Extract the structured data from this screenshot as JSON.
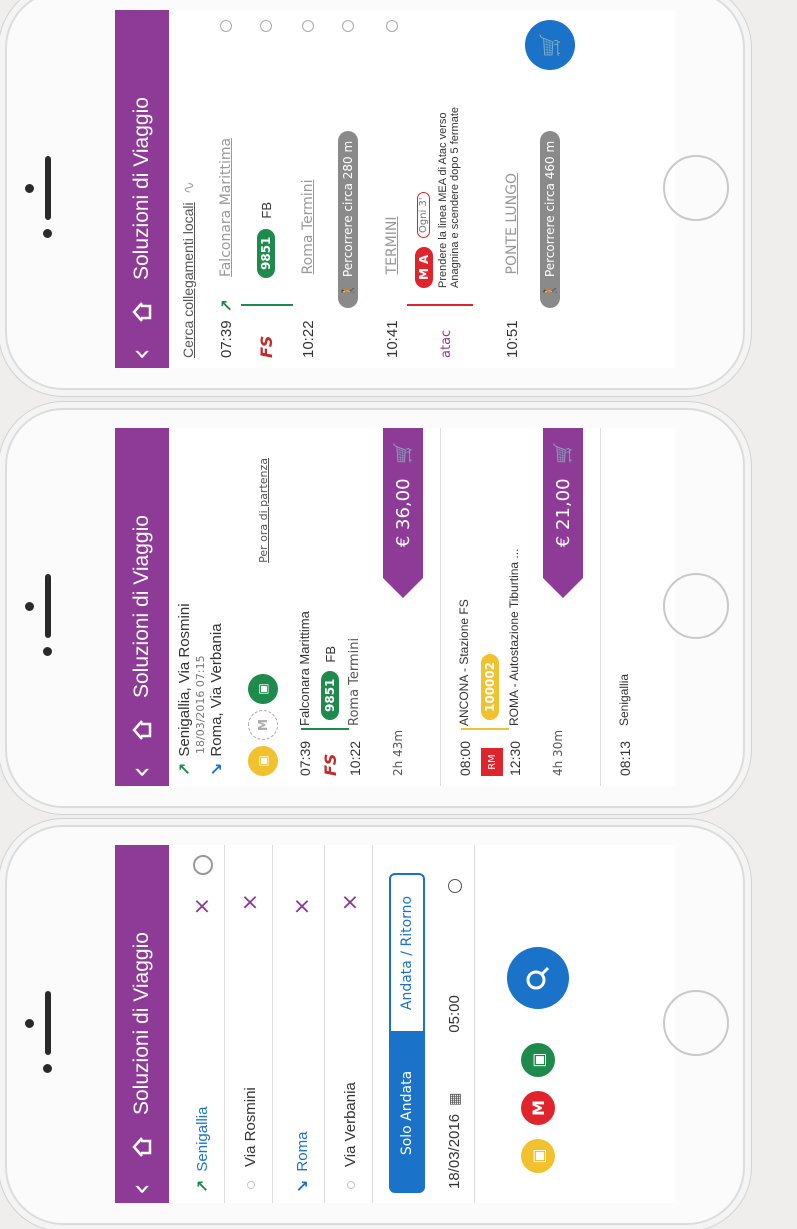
{
  "header": {
    "title": "Soluzioni di Viaggio",
    "back": "‹"
  },
  "search": {
    "from_city": "Senigallia",
    "from_street": "Via Rosmini",
    "to_city": "Roma",
    "to_street": "Via Verbania",
    "tab_oneway": "Solo Andata",
    "tab_return": "Andata / Ritorno",
    "date": "18/03/2016",
    "time": "05:00"
  },
  "results": {
    "from": "Senigallia, Via Rosmini",
    "datetime": "18/03/2016 07:15",
    "to": "Roma, Via Verbania",
    "sort_label": "Per ora di partenza",
    "sol1": {
      "dep_time": "07:39",
      "arr_time": "10:22",
      "dep_station": "Falconara Marittima",
      "arr_station": "Roma Termini",
      "train": "9851",
      "train_type": "FB",
      "duration": "2h 43m",
      "price": "€ 36,00"
    },
    "sol2": {
      "dep_time": "08:00",
      "arr_time": "12:30",
      "dep_station": "ANCONA - Stazione FS",
      "arr_station": "ROMA - Autostazione Tiburtina ...",
      "bus": "100002",
      "duration": "4h 30m",
      "price": "€ 21,00"
    },
    "sol3": {
      "dep_time": "08:13",
      "dep_station": "Senigallia"
    }
  },
  "detail": {
    "search_local": "Cerca collegamenti locali",
    "t1": "07:39",
    "s1": "Falconara Marittima",
    "train": "9851",
    "train_type": "FB",
    "t2": "10:22",
    "s2": "Roma Termini",
    "walk1": "Percorrere circa 280 m",
    "t3": "10:41",
    "s3": "TERMINI",
    "metro": "A",
    "metro_freq": "Ogni 3'",
    "instruction": "Prendere la linea MEA di Atac verso Anagnina e scendere dopo 5 fermate",
    "atac": "atac",
    "t4": "10:51",
    "s4": "PONTE LUNGO",
    "walk2": "Percorrere circa 460 m"
  },
  "colors": {
    "brand": "#8e3b97",
    "blue": "#1a73c9",
    "green": "#1e8a4b",
    "red": "#e0242b",
    "yellow": "#f2c12e"
  }
}
